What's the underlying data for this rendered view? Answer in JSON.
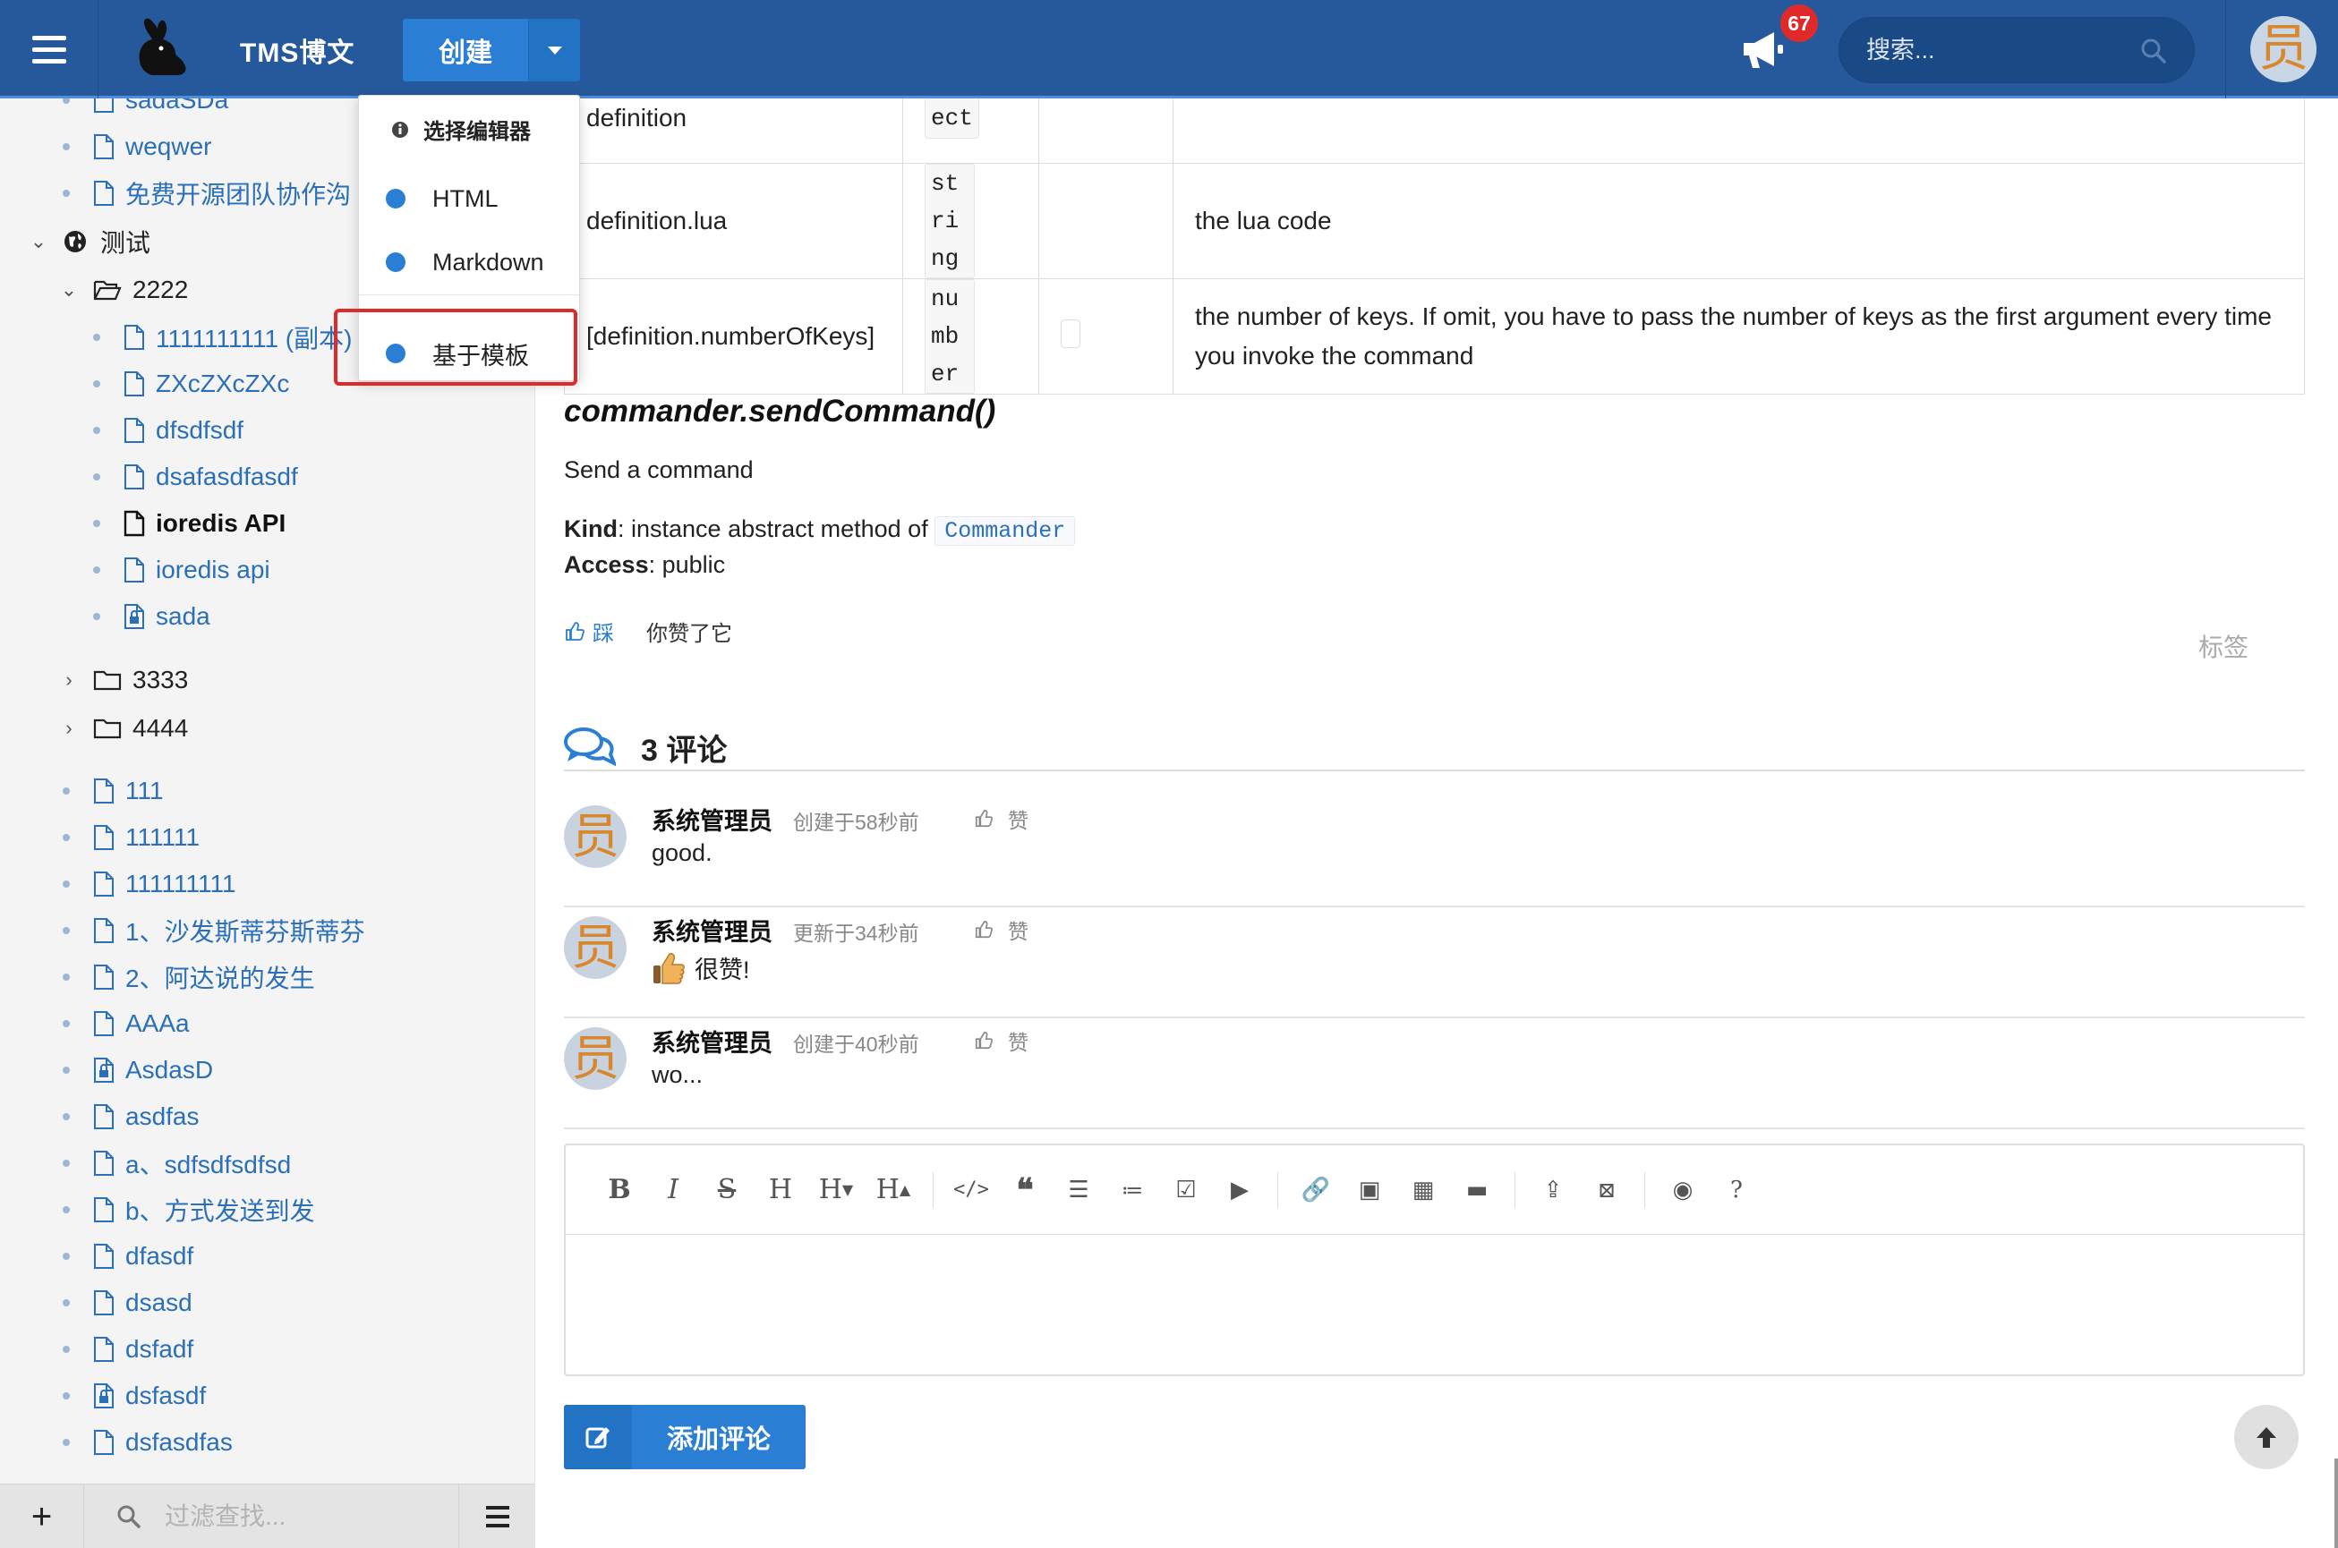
{
  "topbar": {
    "brand": "TMS博文",
    "create_label": "创建",
    "notifications_count": "67",
    "search_placeholder": "搜索...",
    "avatar_char": "员"
  },
  "create_menu": {
    "header": "选择编辑器",
    "items": [
      "HTML",
      "Markdown",
      "基于模板"
    ]
  },
  "sidebar": {
    "items_top": [
      "sadaSDa",
      "weqwer",
      "免费开源团队协作沟"
    ],
    "space": "测试",
    "folder_2222": "2222",
    "folder_items": [
      "1111111111 (副本)",
      "ZXcZXcZXc",
      "dfsdfsdf",
      "dsafasdfasdf",
      "ioredis API",
      "ioredis api",
      "sada"
    ],
    "folders": [
      "3333",
      "4444"
    ],
    "items_bottom": [
      "111",
      "111111",
      "111111111",
      "1、沙发斯蒂芬斯蒂芬",
      "2、阿达说的发生",
      "AAAa",
      "AsdasD",
      "asdfas",
      "a、sdfsdfsdfsd",
      "b、方式发送到发",
      "dfasdf",
      "dsasd",
      "dsfadf",
      "dsfasdf",
      "dsfasdfas"
    ],
    "filter_placeholder": "过滤查找..."
  },
  "main": {
    "table_rows": [
      {
        "name": "definition",
        "type": "ect",
        "desc": ""
      },
      {
        "name": "definition.lua",
        "type": "string",
        "desc": "the lua code"
      },
      {
        "name": "[definition.numberOfKeys]",
        "type": "number",
        "desc": "the number of keys. If omit, you have to pass the number of keys as the first argument every time you invoke the command"
      }
    ],
    "method_title": "commander.sendCommand()",
    "method_desc": "Send a command",
    "kind_label": "Kind",
    "kind_text": ": instance abstract method of",
    "kind_link": "Commander",
    "access_label": "Access",
    "access_text": ": public",
    "like_label": "踩",
    "liked_text": "你赞了它",
    "tags_label": "标签",
    "comments_title": "3 评论",
    "comments": [
      {
        "author": "系统管理员",
        "time": "创建于58秒前",
        "like": "赞",
        "body": "good.",
        "emoji": false
      },
      {
        "author": "系统管理员",
        "time": "更新于34秒前",
        "like": "赞",
        "body": "很赞!",
        "emoji": true
      },
      {
        "author": "系统管理员",
        "time": "创建于40秒前",
        "like": "赞",
        "body": "wo...",
        "emoji": false
      }
    ],
    "add_comment_label": "添加评论"
  },
  "colors": {
    "topbar": "#26599b",
    "primary": "#2a7fd4",
    "badge": "#e02a2a",
    "link": "#2a6fb8"
  }
}
